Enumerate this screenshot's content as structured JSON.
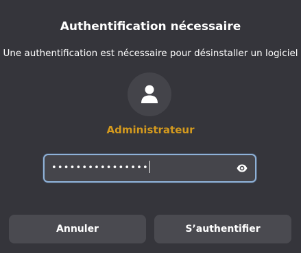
{
  "dialog": {
    "title": "Authentification nécessaire",
    "message": "Une authentification est nécessaire pour désinstaller un logiciel",
    "user": {
      "name": "Administrateur",
      "avatar_icon": "user-icon",
      "name_color": "#d49a1e"
    },
    "password": {
      "masked_value": "••••••••••••••••",
      "reveal_icon": "eye-icon"
    },
    "buttons": {
      "cancel_label": "Annuler",
      "authenticate_label": "S’authentifier"
    }
  },
  "colors": {
    "background": "#35353b",
    "field_border": "#8fb2d8",
    "button_background": "#4a4a50"
  }
}
